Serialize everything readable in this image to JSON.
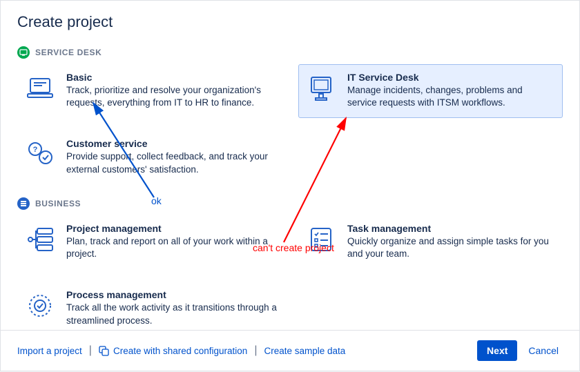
{
  "dialog": {
    "title": "Create project"
  },
  "sections": {
    "service_desk": {
      "label": "SERVICE DESK"
    },
    "business": {
      "label": "BUSINESS"
    }
  },
  "cards": {
    "basic": {
      "title": "Basic",
      "desc": "Track, prioritize and resolve your organization's requests, everything from IT to HR to finance."
    },
    "it_service_desk": {
      "title": "IT Service Desk",
      "desc": "Manage incidents, changes, problems and service requests with ITSM workflows."
    },
    "customer_service": {
      "title": "Customer service",
      "desc": "Provide support, collect feedback, and track your external customers' satisfaction."
    },
    "project_management": {
      "title": "Project management",
      "desc": "Plan, track and report on all of your work within a project."
    },
    "task_management": {
      "title": "Task management",
      "desc": "Quickly organize and assign simple tasks for you and your team."
    },
    "process_management": {
      "title": "Process management",
      "desc": "Track all the work activity as it transitions through a streamlined process."
    }
  },
  "footer": {
    "import": "Import a project",
    "shared_config": "Create with shared configuration",
    "sample_data": "Create sample data",
    "next": "Next",
    "cancel": "Cancel"
  },
  "annotations": {
    "ok": "ok",
    "cant_create": "can't create project"
  },
  "colors": {
    "primary": "#0052cc",
    "selected_bg": "#e6efff",
    "selected_border": "#9fbef0",
    "annot_ok": "#0052cc",
    "annot_err": "#ff0000"
  }
}
